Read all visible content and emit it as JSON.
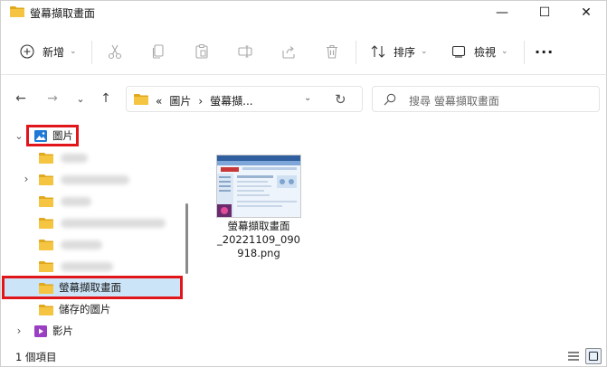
{
  "window": {
    "title": "螢幕擷取畫面",
    "minimize_glyph": "—",
    "maximize_glyph": "☐",
    "close_glyph": "✕"
  },
  "toolbar": {
    "new_label": "新增",
    "sort_label": "排序",
    "view_label": "檢視",
    "more_glyph": "···",
    "icons": [
      "plus-circle-icon",
      "cut-icon",
      "copy-icon",
      "paste-icon",
      "rename-icon",
      "share-icon",
      "delete-icon",
      "sort-icon",
      "view-icon",
      "more-icon"
    ]
  },
  "nav": {
    "back_glyph": "←",
    "forward_glyph": "→",
    "recent_glyph": "⌄",
    "up_glyph": "↑",
    "breadcrumb": [
      "«",
      "圖片",
      "›",
      "螢幕擷..."
    ],
    "dropdown_glyph": "⌄",
    "refresh_glyph": "↻",
    "search_placeholder": "搜尋 螢幕擷取畫面"
  },
  "tree": {
    "root_label": "圖片",
    "selected_label": "螢幕擷取畫面",
    "saved_label": "儲存的圖片",
    "videos_label": "影片",
    "collapse_glyph": "⌄",
    "expand_glyph": "›"
  },
  "content": {
    "file_name_lines": [
      "螢幕擷取畫面",
      "_20221109_090",
      "918.png"
    ]
  },
  "status": {
    "item_count": "1 個項目"
  },
  "colors": {
    "folder_yellow": "#f5c542",
    "folder_dark": "#e0a81c",
    "selection": "#cce4f7",
    "highlight_red": "#e0161b",
    "pictures_blue": "#1e7ad6",
    "videos_purple": "#9a3fc4"
  }
}
